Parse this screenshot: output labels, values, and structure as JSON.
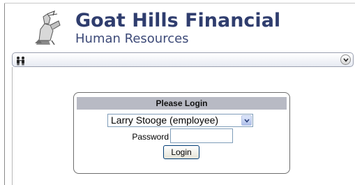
{
  "header": {
    "brand_title": "Goat Hills Financial",
    "brand_subtitle": "Human Resources",
    "title_color": "#2f3d6e"
  },
  "menubar": {
    "menu_icon": "people-icon",
    "toggle_icon": "chevron-down-circle-icon"
  },
  "login": {
    "heading": "Please Login",
    "selected_user": "Larry Stooge (employee)",
    "password_label": "Password",
    "password_value": "",
    "button_label": "Login",
    "header_bg": "#b8bac4"
  }
}
